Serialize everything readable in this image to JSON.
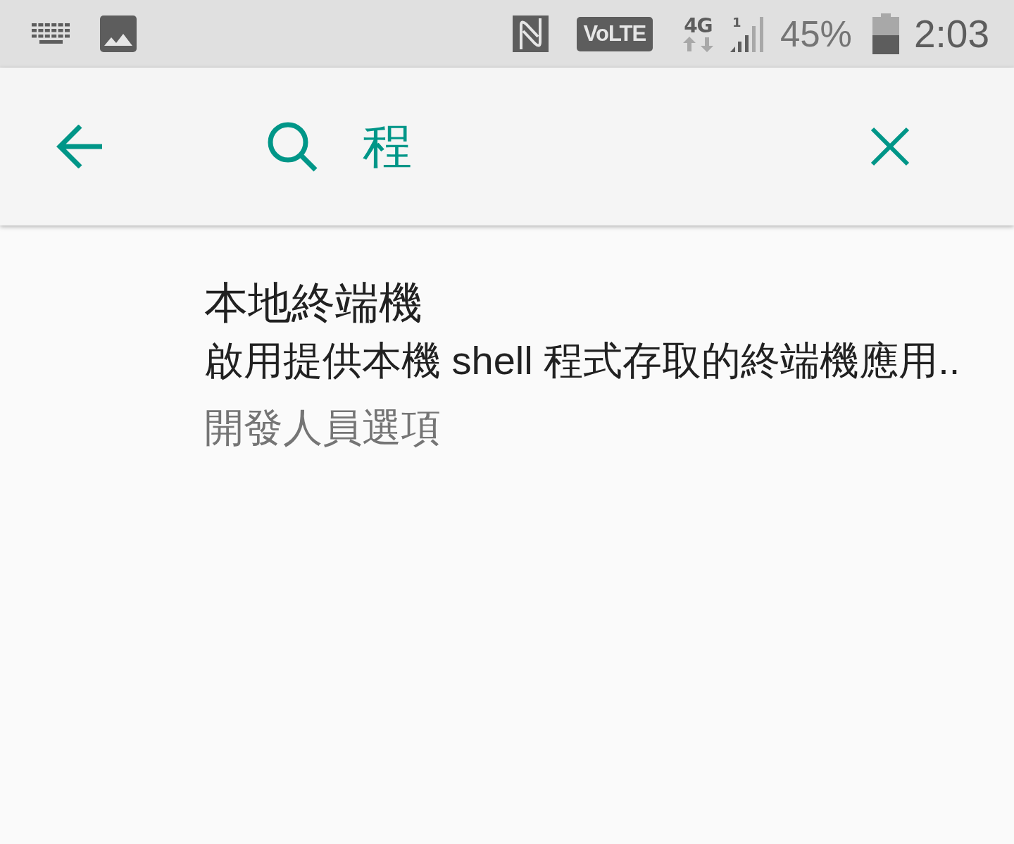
{
  "status_bar": {
    "volte": "VoLTE",
    "network": "4G",
    "sim_slot": "1",
    "battery": "45%",
    "time": "2:03"
  },
  "search_bar": {
    "query": "程"
  },
  "results": [
    {
      "title": "本地終端機",
      "summary": "啟用提供本機 shell 程式存取的終端機應用..",
      "category": "開發人員選項"
    }
  ]
}
